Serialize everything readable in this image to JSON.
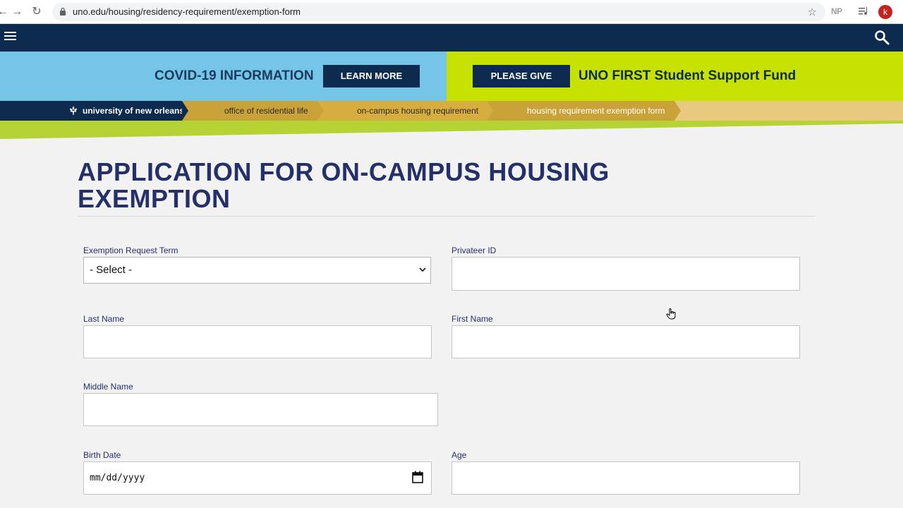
{
  "browser": {
    "url": "uno.edu/housing/residency-requirement/exemption-form",
    "extension_label": "NP",
    "profile_initial": "k"
  },
  "banner": {
    "covid_text": "COVID-19 INFORMATION",
    "learn_more_label": "LEARN MORE",
    "please_give_label": "PLEASE GIVE",
    "fund_text": "UNO FIRST Student Support Fund"
  },
  "breadcrumbs": [
    "university of new orleans",
    "office of residential life",
    "on-campus housing requirement",
    "housing requirement exemption form"
  ],
  "page": {
    "title": "APPLICATION FOR ON-CAMPUS HOUSING EXEMPTION"
  },
  "form": {
    "term_label": "Exemption Request Term",
    "term_value": "- Select -",
    "privateer_id_label": "Privateer ID",
    "last_name_label": "Last Name",
    "first_name_label": "First Name",
    "middle_name_label": "Middle Name",
    "birth_date_label": "Birth Date",
    "birth_date_placeholder": "mm/dd/yyyy",
    "age_label": "Age"
  },
  "colors": {
    "nav_dark": "#0d2b4e",
    "banner_blue": "#75c5e8",
    "banner_green": "#c7e100",
    "title_navy": "#24306a",
    "crumb_gold": "#c9a33a"
  },
  "icons": {
    "menu": "hamburger-icon",
    "search": "search-icon",
    "calendar": "calendar-icon",
    "bookmark": "star-icon"
  }
}
